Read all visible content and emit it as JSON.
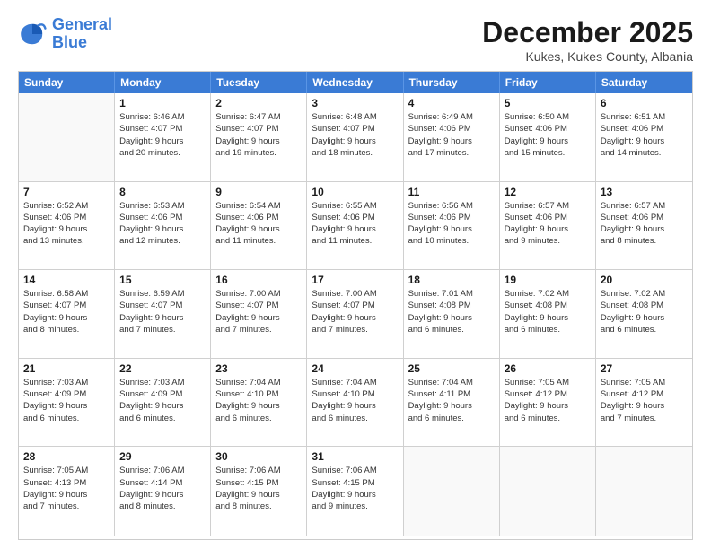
{
  "header": {
    "logo_general": "General",
    "logo_blue": "Blue",
    "month": "December 2025",
    "location": "Kukes, Kukes County, Albania"
  },
  "weekdays": [
    "Sunday",
    "Monday",
    "Tuesday",
    "Wednesday",
    "Thursday",
    "Friday",
    "Saturday"
  ],
  "weeks": [
    [
      {
        "day": "",
        "info": ""
      },
      {
        "day": "1",
        "info": "Sunrise: 6:46 AM\nSunset: 4:07 PM\nDaylight: 9 hours\nand 20 minutes."
      },
      {
        "day": "2",
        "info": "Sunrise: 6:47 AM\nSunset: 4:07 PM\nDaylight: 9 hours\nand 19 minutes."
      },
      {
        "day": "3",
        "info": "Sunrise: 6:48 AM\nSunset: 4:07 PM\nDaylight: 9 hours\nand 18 minutes."
      },
      {
        "day": "4",
        "info": "Sunrise: 6:49 AM\nSunset: 4:06 PM\nDaylight: 9 hours\nand 17 minutes."
      },
      {
        "day": "5",
        "info": "Sunrise: 6:50 AM\nSunset: 4:06 PM\nDaylight: 9 hours\nand 15 minutes."
      },
      {
        "day": "6",
        "info": "Sunrise: 6:51 AM\nSunset: 4:06 PM\nDaylight: 9 hours\nand 14 minutes."
      }
    ],
    [
      {
        "day": "7",
        "info": "Sunrise: 6:52 AM\nSunset: 4:06 PM\nDaylight: 9 hours\nand 13 minutes."
      },
      {
        "day": "8",
        "info": "Sunrise: 6:53 AM\nSunset: 4:06 PM\nDaylight: 9 hours\nand 12 minutes."
      },
      {
        "day": "9",
        "info": "Sunrise: 6:54 AM\nSunset: 4:06 PM\nDaylight: 9 hours\nand 11 minutes."
      },
      {
        "day": "10",
        "info": "Sunrise: 6:55 AM\nSunset: 4:06 PM\nDaylight: 9 hours\nand 11 minutes."
      },
      {
        "day": "11",
        "info": "Sunrise: 6:56 AM\nSunset: 4:06 PM\nDaylight: 9 hours\nand 10 minutes."
      },
      {
        "day": "12",
        "info": "Sunrise: 6:57 AM\nSunset: 4:06 PM\nDaylight: 9 hours\nand 9 minutes."
      },
      {
        "day": "13",
        "info": "Sunrise: 6:57 AM\nSunset: 4:06 PM\nDaylight: 9 hours\nand 8 minutes."
      }
    ],
    [
      {
        "day": "14",
        "info": "Sunrise: 6:58 AM\nSunset: 4:07 PM\nDaylight: 9 hours\nand 8 minutes."
      },
      {
        "day": "15",
        "info": "Sunrise: 6:59 AM\nSunset: 4:07 PM\nDaylight: 9 hours\nand 7 minutes."
      },
      {
        "day": "16",
        "info": "Sunrise: 7:00 AM\nSunset: 4:07 PM\nDaylight: 9 hours\nand 7 minutes."
      },
      {
        "day": "17",
        "info": "Sunrise: 7:00 AM\nSunset: 4:07 PM\nDaylight: 9 hours\nand 7 minutes."
      },
      {
        "day": "18",
        "info": "Sunrise: 7:01 AM\nSunset: 4:08 PM\nDaylight: 9 hours\nand 6 minutes."
      },
      {
        "day": "19",
        "info": "Sunrise: 7:02 AM\nSunset: 4:08 PM\nDaylight: 9 hours\nand 6 minutes."
      },
      {
        "day": "20",
        "info": "Sunrise: 7:02 AM\nSunset: 4:08 PM\nDaylight: 9 hours\nand 6 minutes."
      }
    ],
    [
      {
        "day": "21",
        "info": "Sunrise: 7:03 AM\nSunset: 4:09 PM\nDaylight: 9 hours\nand 6 minutes."
      },
      {
        "day": "22",
        "info": "Sunrise: 7:03 AM\nSunset: 4:09 PM\nDaylight: 9 hours\nand 6 minutes."
      },
      {
        "day": "23",
        "info": "Sunrise: 7:04 AM\nSunset: 4:10 PM\nDaylight: 9 hours\nand 6 minutes."
      },
      {
        "day": "24",
        "info": "Sunrise: 7:04 AM\nSunset: 4:10 PM\nDaylight: 9 hours\nand 6 minutes."
      },
      {
        "day": "25",
        "info": "Sunrise: 7:04 AM\nSunset: 4:11 PM\nDaylight: 9 hours\nand 6 minutes."
      },
      {
        "day": "26",
        "info": "Sunrise: 7:05 AM\nSunset: 4:12 PM\nDaylight: 9 hours\nand 6 minutes."
      },
      {
        "day": "27",
        "info": "Sunrise: 7:05 AM\nSunset: 4:12 PM\nDaylight: 9 hours\nand 7 minutes."
      }
    ],
    [
      {
        "day": "28",
        "info": "Sunrise: 7:05 AM\nSunset: 4:13 PM\nDaylight: 9 hours\nand 7 minutes."
      },
      {
        "day": "29",
        "info": "Sunrise: 7:06 AM\nSunset: 4:14 PM\nDaylight: 9 hours\nand 8 minutes."
      },
      {
        "day": "30",
        "info": "Sunrise: 7:06 AM\nSunset: 4:15 PM\nDaylight: 9 hours\nand 8 minutes."
      },
      {
        "day": "31",
        "info": "Sunrise: 7:06 AM\nSunset: 4:15 PM\nDaylight: 9 hours\nand 9 minutes."
      },
      {
        "day": "",
        "info": ""
      },
      {
        "day": "",
        "info": ""
      },
      {
        "day": "",
        "info": ""
      }
    ]
  ]
}
